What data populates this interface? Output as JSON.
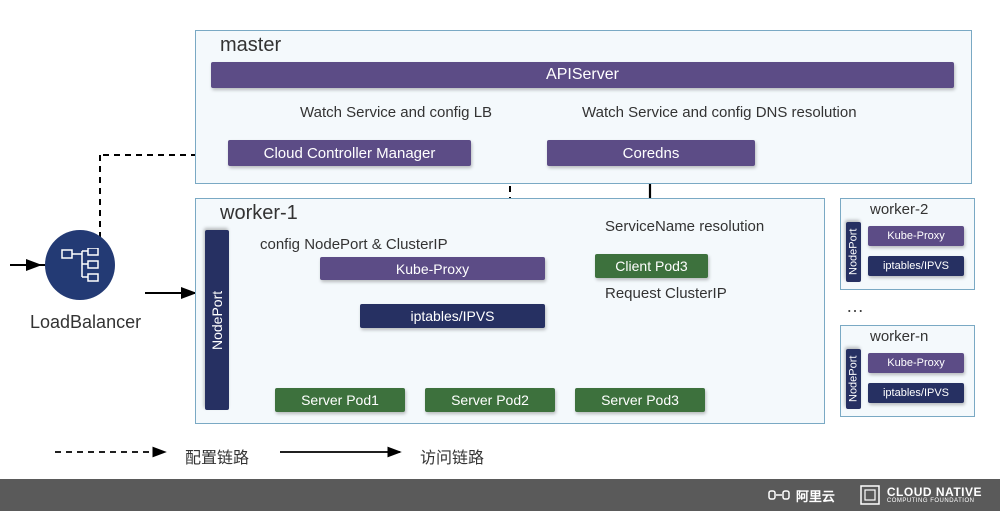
{
  "master": {
    "title": "master",
    "apiserver": "APIServer",
    "ccm": "Cloud Controller Manager",
    "coredns": "Coredns",
    "watch_lb": "Watch Service and config LB",
    "watch_dns": "Watch Service and config DNS resolution"
  },
  "loadbalancer": {
    "label": "LoadBalancer"
  },
  "worker1": {
    "title": "worker-1",
    "nodeport": "NodePort",
    "cfg_np": "config NodePort & ClusterIP",
    "kube_proxy": "Kube-Proxy",
    "ipvs": "iptables/IPVS",
    "client_pod": "Client Pod3",
    "svc_name_res": "ServiceName resolution",
    "req_cip": "Request ClusterIP",
    "server_pod1": "Server Pod1",
    "server_pod2": "Server Pod2",
    "server_pod3": "Server Pod3"
  },
  "worker2": {
    "title": "worker-2",
    "nodeport": "NodePort",
    "kube_proxy": "Kube-Proxy",
    "ipvs": "iptables/IPVS"
  },
  "ellipsis": "…",
  "workern": {
    "title": "worker-n",
    "nodeport": "NodePort",
    "kube_proxy": "Kube-Proxy",
    "ipvs": "iptables/IPVS"
  },
  "legend": {
    "config_path": "配置链路",
    "access_path": "访问链路"
  },
  "footer": {
    "aliyun": "阿里云",
    "cncf_top": "CLOUD NATIVE",
    "cncf_bottom": "COMPUTING FOUNDATION"
  }
}
